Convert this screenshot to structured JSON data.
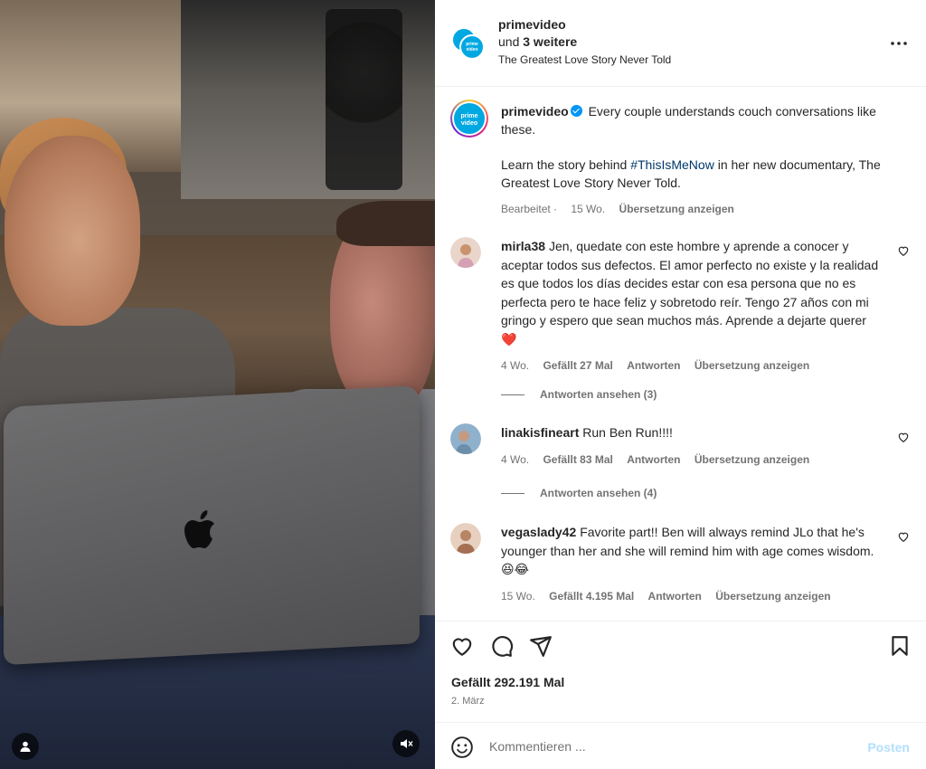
{
  "header": {
    "username": "primevideo",
    "collab_prefix": "und",
    "collab_count": "3 weitere",
    "audio_title": "The Greatest Love Story Never Told",
    "more_icon": "more-horizontal-icon"
  },
  "caption": {
    "username": "primevideo",
    "line1": "Every couple understands couch conversations like these.",
    "line2_pre": "Learn the story behind ",
    "hashtag": "#ThisIsMeNow",
    "line2_post": " in her new documentary, The Greatest Love Story Never Told.",
    "edited": "Bearbeitet",
    "age": "15 Wo.",
    "translate": "Übersetzung anzeigen"
  },
  "comments": [
    {
      "username": "mirla38",
      "text": "Jen, quedate con este hombre y aprende a conocer y aceptar todos sus defectos. El amor perfecto no existe y la realidad es que todos los días decides estar con esa persona que no es perfecta pero te hace feliz y sobretodo reír. Tengo 27 años con mi gringo y espero que sean muchos más. Aprende a dejarte querer ❤️",
      "age": "4 Wo.",
      "likes": "Gefällt 27 Mal",
      "reply": "Antworten",
      "translate": "Übersetzung anzeigen",
      "view_replies": "Antworten ansehen (3)"
    },
    {
      "username": "linakisfineart",
      "text": "Run Ben Run!!!!",
      "age": "4 Wo.",
      "likes": "Gefällt 83 Mal",
      "reply": "Antworten",
      "translate": "Übersetzung anzeigen",
      "view_replies": "Antworten ansehen (4)"
    },
    {
      "username": "vegaslady42",
      "text": "Favorite part!! Ben will always remind JLo that he's younger than her and she will remind him with age comes wisdom. 😆😂",
      "age": "15 Wo.",
      "likes": "Gefällt 4.195 Mal",
      "reply": "Antworten",
      "translate": "Übersetzung anzeigen"
    }
  ],
  "actions": {
    "like_icon": "heart-icon",
    "comment_icon": "comment-icon",
    "share_icon": "share-icon",
    "save_icon": "bookmark-icon",
    "likes": "Gefällt 292.191 Mal",
    "date": "2. März"
  },
  "composer": {
    "placeholder": "Kommentieren ...",
    "post_label": "Posten",
    "emoji_icon": "emoji-icon"
  },
  "colors": {
    "primevideo_blue": "#00a8e1",
    "link": "#00376b",
    "muted": "#737373",
    "verified": "#0095f6"
  }
}
